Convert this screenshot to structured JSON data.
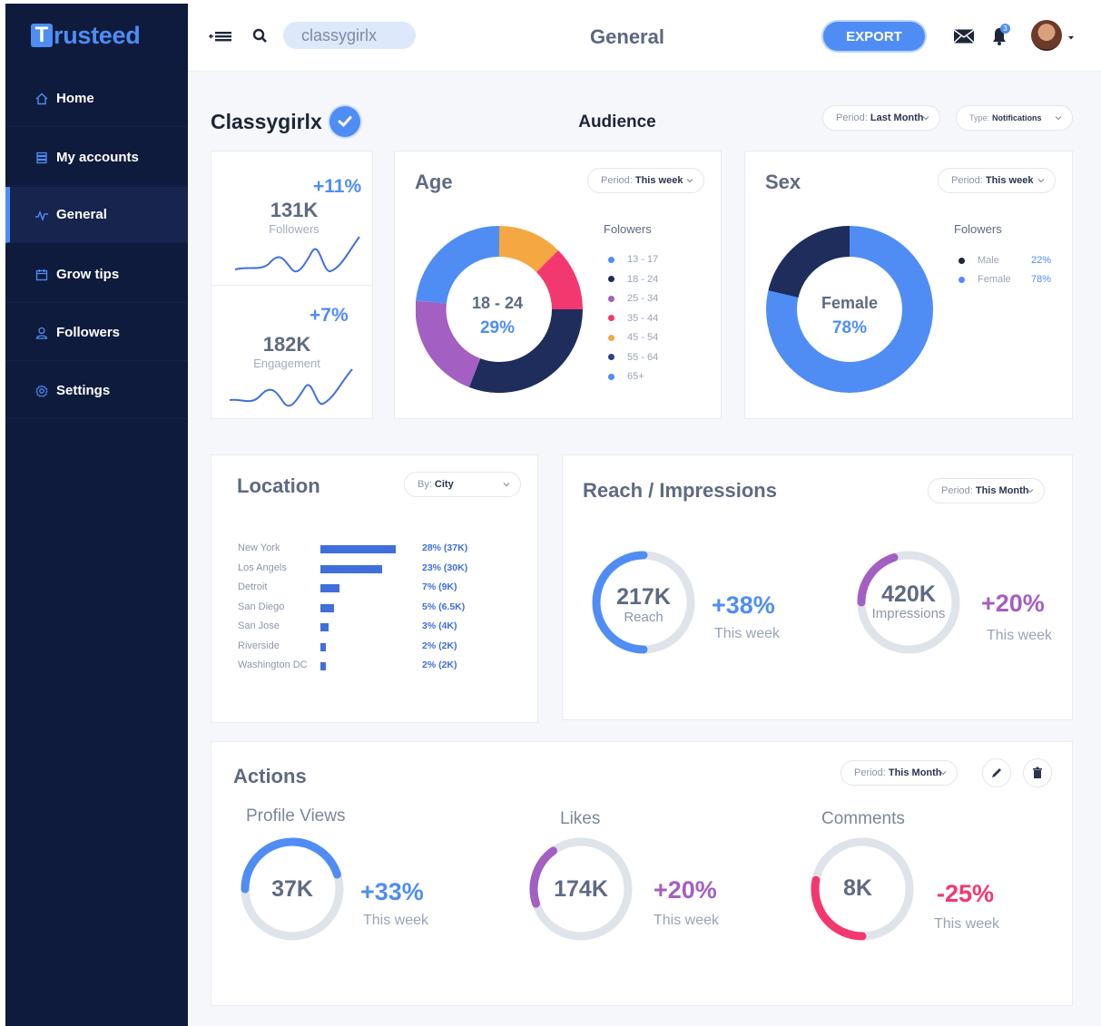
{
  "brand": {
    "logo_letter": "T",
    "logo_rest": "rusteed"
  },
  "sidebar": {
    "items": [
      {
        "label": "Home",
        "icon": "home-icon"
      },
      {
        "label": "My accounts",
        "icon": "accounts-icon"
      },
      {
        "label": "General",
        "icon": "pulse-icon",
        "active": true
      },
      {
        "label": "Grow tips",
        "icon": "calendar-icon"
      },
      {
        "label": "Followers",
        "icon": "user-icon"
      },
      {
        "label": "Settings",
        "icon": "gear-icon"
      }
    ]
  },
  "topbar": {
    "search_value": "classygirlx",
    "title": "General",
    "export_label": "EXPORT",
    "notification_count": "3"
  },
  "header": {
    "username": "Classygirlx",
    "audience_title": "Audience",
    "period_label": "Period:",
    "period_value": "Last Month",
    "type_label": "Type:",
    "type_value": "Notifications"
  },
  "stats": {
    "followers": {
      "value": "131K",
      "label": "Followers",
      "change": "+11%"
    },
    "engagement": {
      "value": "182K",
      "label": "Engagement",
      "change": "+7%"
    }
  },
  "age": {
    "title": "Age",
    "period_label": "Period:",
    "period_value": "This week",
    "legend_title": "Folowers",
    "center_range": "18 - 24",
    "center_pct": "29%",
    "legend": [
      "13 - 17",
      "18 - 24",
      "25 - 34",
      "35 - 44",
      "45 - 54",
      "55 - 64",
      "65+"
    ],
    "legend_colors": [
      "#4f8df5",
      "#1f2d5c",
      "#a35fc2",
      "#f2386e",
      "#f5a742",
      "#2b3f8c",
      "#4f8df5"
    ]
  },
  "sex": {
    "title": "Sex",
    "period_label": "Period:",
    "period_value": "This week",
    "legend_title": "Folowers",
    "center_label": "Female",
    "center_pct": "78%",
    "legend": [
      {
        "label": "Male",
        "value": "22%",
        "color": "#1e2638"
      },
      {
        "label": "Female",
        "value": "78%",
        "color": "#4f8df5"
      }
    ]
  },
  "location": {
    "title": "Location",
    "by_label": "By:",
    "by_value": "City",
    "rows": [
      {
        "city": "New York",
        "value": "28% (37K)",
        "pct": 28
      },
      {
        "city": "Los Angels",
        "value": "23% (30K)",
        "pct": 23
      },
      {
        "city": "Detroit",
        "value": "7% (9K)",
        "pct": 7
      },
      {
        "city": "San Diego",
        "value": "5% (6.5K)",
        "pct": 5
      },
      {
        "city": "San Jose",
        "value": "3% (4K)",
        "pct": 3
      },
      {
        "city": "Riverside",
        "value": "2% (2K)",
        "pct": 2
      },
      {
        "city": "Washington DC",
        "value": "2% (2K)",
        "pct": 2
      }
    ]
  },
  "reach": {
    "title": "Reach / Impressions",
    "period_label": "Period:",
    "period_value": "This Month",
    "reach": {
      "value": "217K",
      "label": "Reach",
      "change": "+38%",
      "sub": "This week",
      "fraction": 0.5
    },
    "impressions": {
      "value": "420K",
      "label": "Impressions",
      "change": "+20%",
      "sub": "This week",
      "fraction": 0.2
    }
  },
  "actions": {
    "title": "Actions",
    "period_label": "Period:",
    "period_value": "This Month",
    "items": [
      {
        "label": "Profile Views",
        "value": "37K",
        "change": "+33%",
        "sub": "This week",
        "fraction": 0.45,
        "color": "#4f8df5"
      },
      {
        "label": "Likes",
        "value": "174K",
        "change": "+20%",
        "sub": "This week",
        "fraction": 0.2,
        "color": "#a35fc2"
      },
      {
        "label": "Comments",
        "value": "8K",
        "change": "-25%",
        "sub": "This week",
        "fraction": 0.28,
        "color": "#f2386e"
      }
    ]
  },
  "colors": {
    "accent": "#4f8df5",
    "sidebar": "#0f1b3d",
    "purple": "#a35fc2",
    "pink": "#f2386e",
    "navy": "#1f2d5c",
    "orange": "#f5a742"
  }
}
